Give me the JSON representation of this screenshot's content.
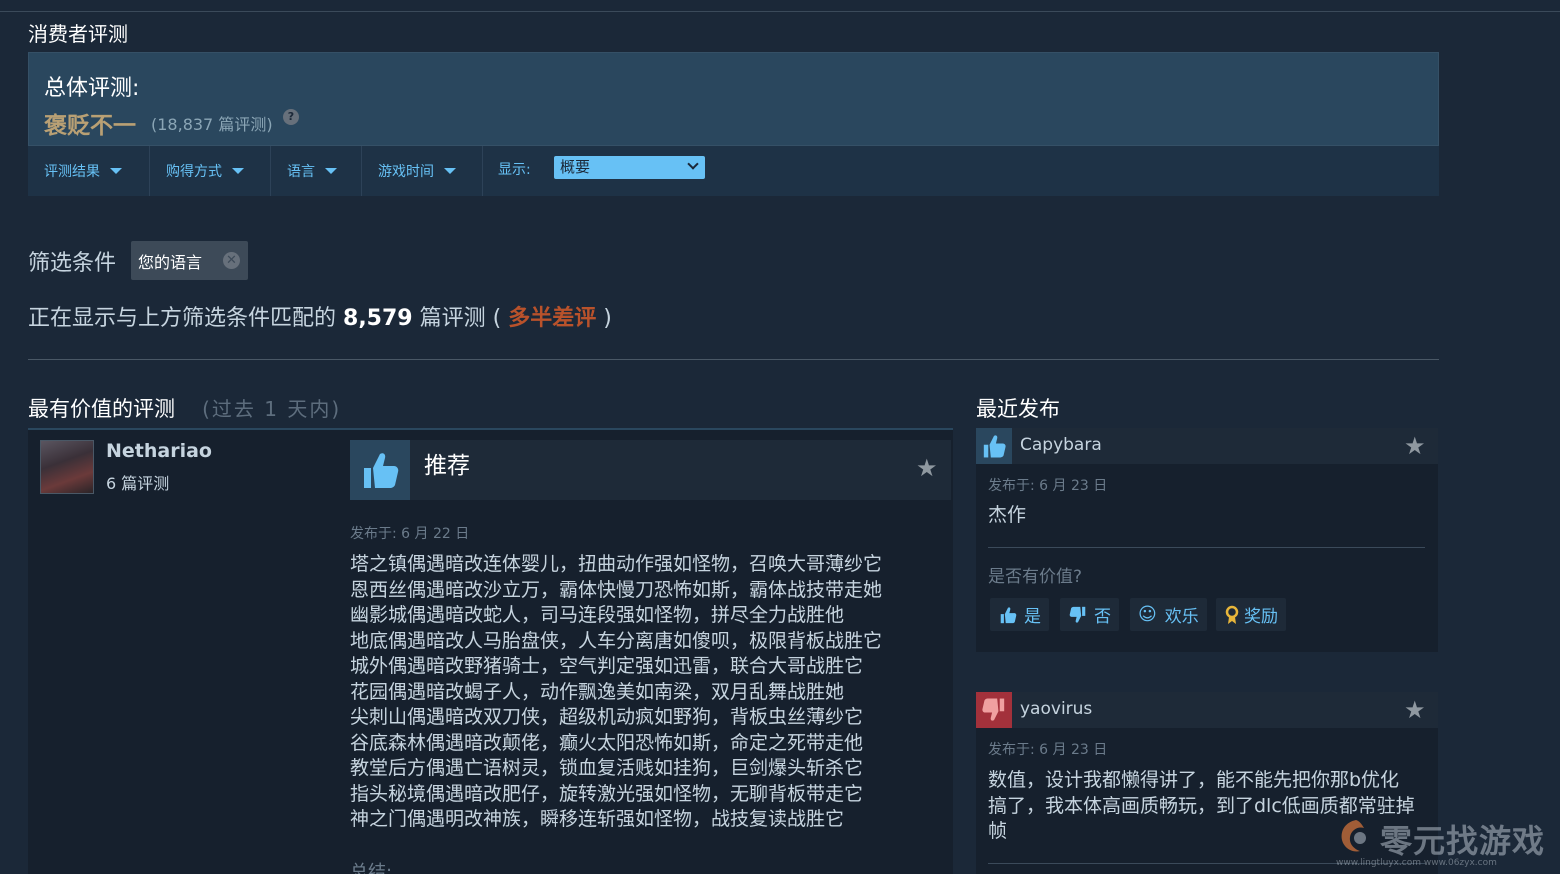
{
  "header": {
    "section_title": "消费者评测"
  },
  "summary": {
    "label": "总体评测:",
    "verdict": "褒贬不一",
    "count": "(18,837 篇评测)",
    "help_icon": "?"
  },
  "filters": {
    "items": [
      {
        "label": "评测结果"
      },
      {
        "label": "购得方式"
      },
      {
        "label": "语言"
      },
      {
        "label": "游戏时间"
      }
    ],
    "display_label": "显示:",
    "display_value": "概要"
  },
  "active_filters": {
    "label": "筛选条件",
    "chip": "您的语言",
    "chip_close": "✕"
  },
  "match": {
    "prefix": "正在显示与上方筛选条件匹配的",
    "count": "8,579",
    "suffix": "篇评测 (",
    "verdict": "多半差评",
    "close": ")"
  },
  "colors": {
    "accent": "#67c1f5",
    "mixed": "#b9a074",
    "negative": "#b9522b",
    "background": "#1b2838"
  },
  "left_column": {
    "title": "最有价值的评测",
    "subtitle": "(过去 1 天内)",
    "review": {
      "user": "Nethariao",
      "user_reviews": "6 篇评测",
      "recommendation": "推荐",
      "posted": "发布于: 6 月 22 日",
      "lines": [
        "塔之镇偶遇暗改连体婴儿，扭曲动作强如怪物，召唤大哥薄纱它",
        "恩西丝偶遇暗改沙立万，霸体快慢刀恐怖如斯，霸体战技带走她",
        "幽影城偶遇暗改蛇人，司马连段强如怪物，拼尽全力战胜他",
        "地底偶遇暗改人马胎盘侠，人车分离唐如傻呗，极限背板战胜它",
        "城外偶遇暗改野猪骑士，空气判定强如迅雷，联合大哥战胜它",
        "花园偶遇暗改蝎子人，动作飘逸美如南梁，双月乱舞战胜她",
        "尖刺山偶遇暗改双刀侠，超级机动疯如野狗，背板虫丝薄纱它",
        "谷底森林偶遇暗改颠佬，癫火太阳恐怖如斯，命定之死带走他",
        "教堂后方偶遇亡语树灵，锁血复活贱如挂狗，巨剑爆头斩杀它",
        "指头秘境偶遇暗改肥仔，旋转激光强如怪物，无聊背板带走它",
        "神之门偶遇明改神族，瞬移连斩强如怪物，战技复读战胜它"
      ],
      "summary_label": "总结:"
    }
  },
  "right_column": {
    "title": "最近发布",
    "cards": [
      {
        "user": "Capybara",
        "type": "thumbs-up",
        "posted": "发布于: 6 月 23 日",
        "text": "杰作",
        "helpful_label": "是否有价值?",
        "buttons": {
          "yes": "是",
          "no": "否",
          "funny": "欢乐",
          "award": "奖励"
        }
      },
      {
        "user": "yaovirus",
        "type": "thumbs-down",
        "posted": "发布于: 6 月 23 日",
        "lines": [
          "数值，设计我都懒得讲了，能不能先把你那b优化",
          "搞了，我本体高画质畅玩，到了dlc低画质都常驻掉",
          "帧"
        ]
      }
    ]
  },
  "watermark": {
    "text": "零元找游戏",
    "url": "www.lingtluyx.com  www.06zyx.com"
  }
}
